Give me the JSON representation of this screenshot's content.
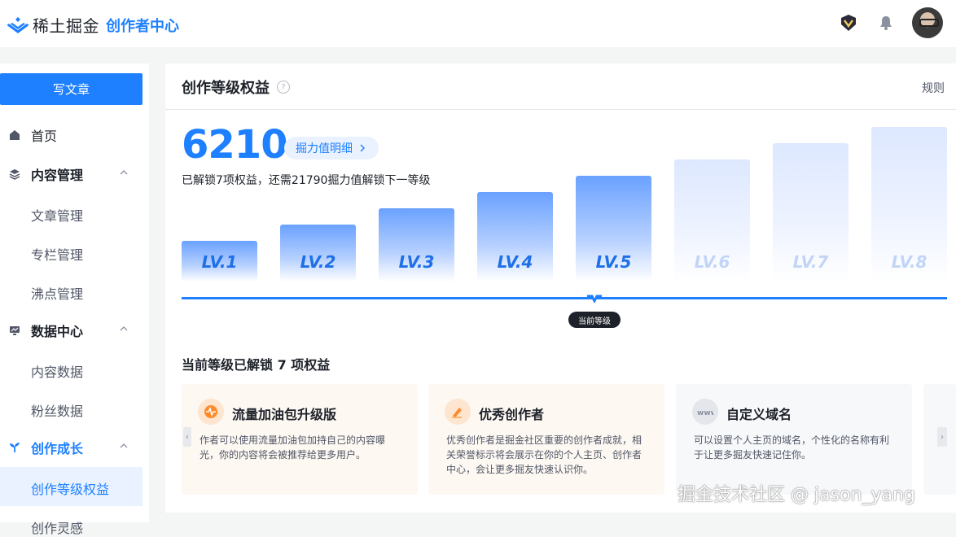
{
  "header": {
    "brand": "稀土掘金",
    "subtitle": "创作者中心",
    "icons": [
      "badge-icon",
      "bell-icon"
    ]
  },
  "sidebar": {
    "write_button": "写文章",
    "items": [
      {
        "label": "首页",
        "icon": "home-icon"
      },
      {
        "label": "内容管理",
        "icon": "layers-icon",
        "children": [
          "文章管理",
          "专栏管理",
          "沸点管理"
        ]
      },
      {
        "label": "数据中心",
        "icon": "monitor-chart-icon",
        "children": [
          "内容数据",
          "粉丝数据"
        ]
      },
      {
        "label": "创作成长",
        "icon": "growth-icon",
        "children": [
          "创作等级权益",
          "创作灵感"
        ]
      }
    ]
  },
  "main": {
    "title": "创作等级权益",
    "rules_link": "规则",
    "score": "6210",
    "score_button": "掘力值明细",
    "unlock_text": "已解锁7项权益，还需21790掘力值解锁下一等级",
    "levels": [
      {
        "label": "LV.1",
        "unlocked": true
      },
      {
        "label": "LV.2",
        "unlocked": true
      },
      {
        "label": "LV.3",
        "unlocked": true
      },
      {
        "label": "LV.4",
        "unlocked": true
      },
      {
        "label": "LV.5",
        "unlocked": true
      },
      {
        "label": "LV.6",
        "unlocked": false
      },
      {
        "label": "LV.7",
        "unlocked": false
      },
      {
        "label": "LV.8",
        "unlocked": false
      }
    ],
    "current_level_tag": "当前等级",
    "section_title": "当前等级已解锁 7 项权益",
    "cards": [
      {
        "title": "流量加油包升级版",
        "desc": "作者可以使用流量加油包加持自己的内容曝光，你的内容将会被推荐给更多用户。",
        "icon": "fuel-pack-icon",
        "bg": "#fdf8f2",
        "icon_bg": "#fde5cf"
      },
      {
        "title": "优秀创作者",
        "desc": "优秀创作者是掘金社区重要的创作者成就，相关荣誉标示将会展示在你的个人主页、创作者中心，会让更多掘友快速认识你。",
        "icon": "pen-badge-icon",
        "bg": "#fdf8f2",
        "icon_bg": "#fde5cf"
      },
      {
        "title": "自定义域名",
        "desc": "可以设置个人主页的域名，个性化的名称有利于让更多掘友快速记住你。",
        "icon": "domain-icon",
        "bg": "#f7f8fa",
        "icon_bg": "#e5e6eb"
      }
    ]
  },
  "watermark": "掘金技术社区 @ jason_yang"
}
